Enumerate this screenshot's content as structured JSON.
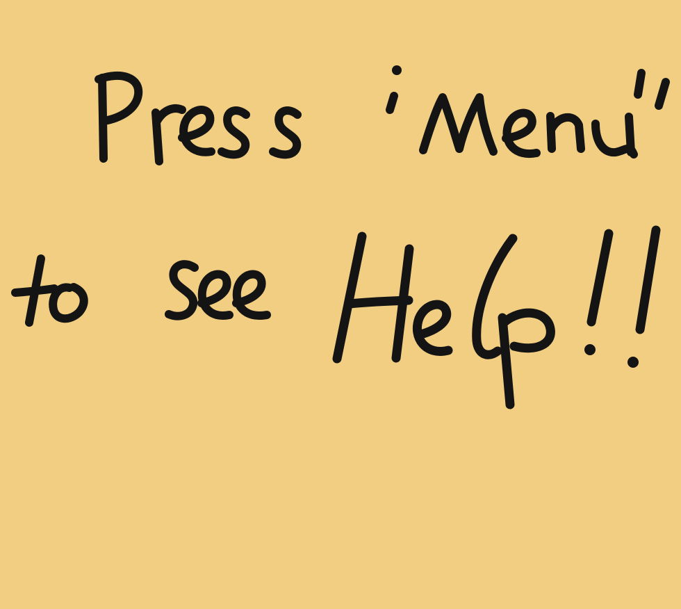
{
  "note": {
    "line1": "Press “Menu”",
    "line2": "to see Help!!",
    "background_color": "#f2ce82",
    "ink_color": "#141414"
  }
}
